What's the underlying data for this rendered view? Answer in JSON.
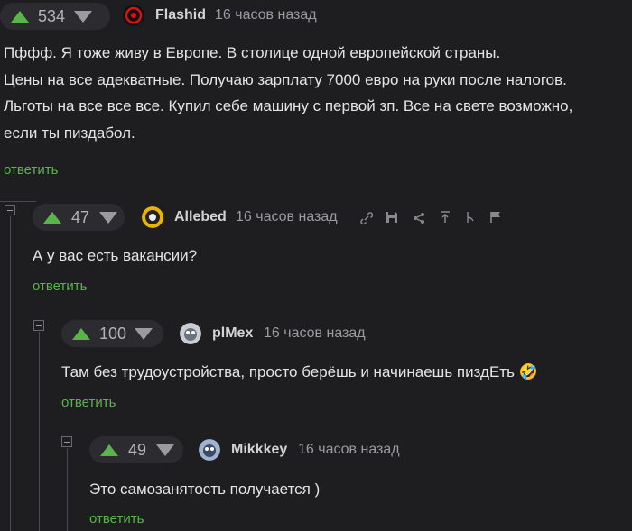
{
  "comments": [
    {
      "rating": "534",
      "user": "Flashid",
      "time": "16 часов назад",
      "lines": [
        "Пффф. Я тоже живу в Европе. В столице одной европейской страны.",
        "Цены на все адекватные. Получаю зарплату 7000 евро на руки после налогов.",
        "Льготы на все все все. Купил себе машину с первой зп. Все на свете возможно,",
        "если ты пиздабол."
      ],
      "reply": "ответить"
    },
    {
      "rating": "47",
      "user": "Allebed",
      "time": "16 часов назад",
      "lines": [
        "А у вас есть вакансии?"
      ],
      "reply": "ответить"
    },
    {
      "rating": "100",
      "user": "plMex",
      "time": "16 часов назад",
      "lines": [
        "Там без трудоустройства, просто берёшь и начинаешь пиздЕть"
      ],
      "emoji": "🤣",
      "reply": "ответить"
    },
    {
      "rating": "49",
      "user": "Mikkkey",
      "time": "16 часов назад",
      "lines": [
        "Это самозанятость получается )"
      ],
      "reply": "ответить"
    }
  ],
  "actions": [
    "link-icon",
    "save-icon",
    "share-icon",
    "up-thread-icon",
    "branch-icon",
    "flag-icon"
  ],
  "colors": {
    "background": "#1e1e21",
    "accent": "#59b54a",
    "text": "#e4e4e4",
    "muted": "#9b9b9f"
  }
}
